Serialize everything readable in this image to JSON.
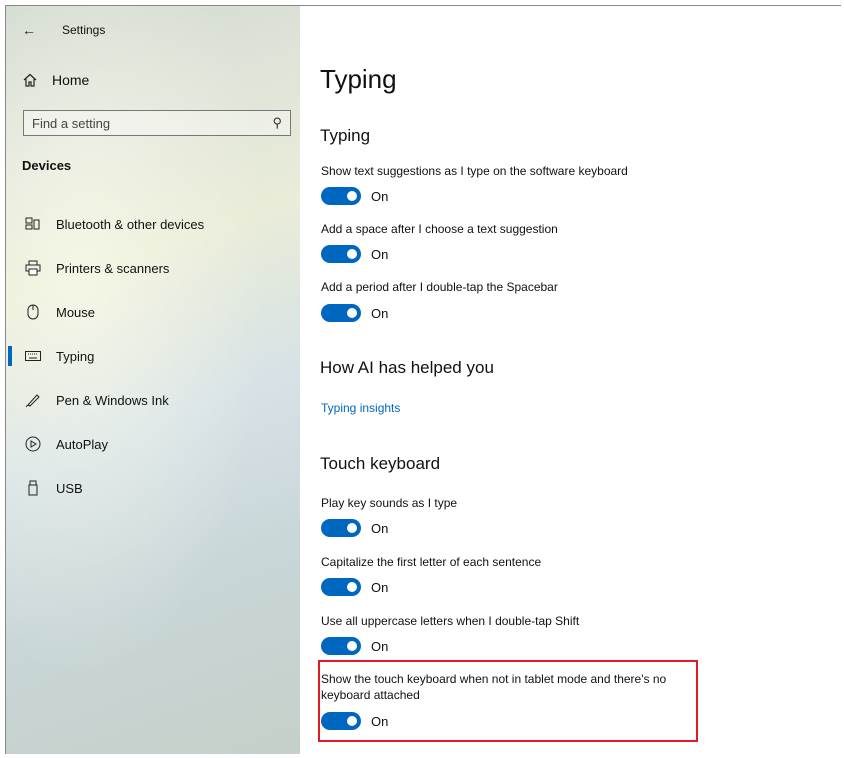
{
  "window": {
    "title": "Settings"
  },
  "sidebar": {
    "home_label": "Home",
    "search_placeholder": "Find a setting",
    "section": "Devices",
    "items": [
      {
        "label": "Bluetooth & other devices",
        "icon": "bluetooth-devices-icon"
      },
      {
        "label": "Printers & scanners",
        "icon": "printer-icon"
      },
      {
        "label": "Mouse",
        "icon": "mouse-icon"
      },
      {
        "label": "Typing",
        "icon": "keyboard-icon",
        "active": true
      },
      {
        "label": "Pen & Windows Ink",
        "icon": "pen-icon"
      },
      {
        "label": "AutoPlay",
        "icon": "autoplay-icon"
      },
      {
        "label": "USB",
        "icon": "usb-icon"
      }
    ]
  },
  "main": {
    "title": "Typing",
    "typing": {
      "heading": "Typing",
      "settings": [
        {
          "label": "Show text suggestions as I type on the software keyboard",
          "state": "On"
        },
        {
          "label": "Add a space after I choose a text suggestion",
          "state": "On"
        },
        {
          "label": "Add a period after I double-tap the Spacebar",
          "state": "On"
        }
      ]
    },
    "ai": {
      "heading": "How AI has helped you",
      "link": "Typing insights"
    },
    "touch": {
      "heading": "Touch keyboard",
      "settings": [
        {
          "label": "Play key sounds as I type",
          "state": "On"
        },
        {
          "label": "Capitalize the first letter of each sentence",
          "state": "On"
        },
        {
          "label": "Use all uppercase letters when I double-tap Shift",
          "state": "On"
        },
        {
          "label_line1": "Show the touch keyboard when not in tablet mode and there's no",
          "label_line2": "keyboard attached",
          "state": "On"
        }
      ]
    }
  },
  "accent_color": "#0067c0",
  "highlight_color": "#e01b24"
}
